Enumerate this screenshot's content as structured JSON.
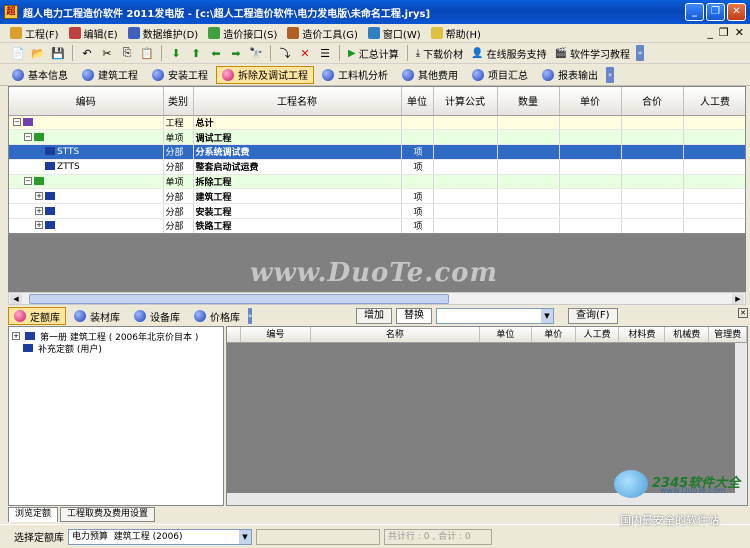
{
  "window": {
    "title": "超人电力工程造价软件 2011发电版 - [c:\\超人工程造价软件\\电力发电版\\未命名工程.jrys]",
    "minimize": "_",
    "restore": "❐",
    "close": "✕"
  },
  "menu": {
    "items": [
      "工程(F)",
      "编辑(E)",
      "数据维护(D)",
      "造价接口(S)",
      "造价工具(G)",
      "窗口(W)",
      "帮助(H)"
    ],
    "mdi_controls": [
      "_",
      "❐",
      "✕"
    ]
  },
  "toolbar": {
    "summary_label": "汇总计算",
    "download_price_label": "下载价材",
    "online_service_label": "在线服务支持",
    "tutorial_label": "软件学习教程"
  },
  "tabs": {
    "items": [
      "基本信息",
      "建筑工程",
      "安装工程",
      "拆除及调试工程",
      "工料机分析",
      "其他费用",
      "项目汇总",
      "报表输出"
    ],
    "active": "拆除及调试工程"
  },
  "grid": {
    "columns": [
      "编码",
      "类别",
      "工程名称",
      "单位",
      "计算公式",
      "数量",
      "单价",
      "合价",
      "人工费"
    ],
    "rows": [
      {
        "code": "",
        "type": "工程",
        "name": "总计",
        "unit": "",
        "style": "sum",
        "level": 0
      },
      {
        "code": "",
        "type": "单项",
        "name": "调试工程",
        "unit": "",
        "style": "item",
        "level": 1
      },
      {
        "code": "STTS",
        "type": "分部",
        "name": "分系统调试费",
        "unit": "项",
        "style": "sel",
        "level": 2
      },
      {
        "code": "ZTTS",
        "type": "分部",
        "name": "整套启动试运费",
        "unit": "项",
        "style": "",
        "level": 2
      },
      {
        "code": "",
        "type": "单项",
        "name": "拆除工程",
        "unit": "",
        "style": "item",
        "level": 1
      },
      {
        "code": "",
        "type": "分部",
        "name": "建筑工程",
        "unit": "项",
        "style": "",
        "level": 2
      },
      {
        "code": "",
        "type": "分部",
        "name": "安装工程",
        "unit": "项",
        "style": "",
        "level": 2
      },
      {
        "code": "",
        "type": "分部",
        "name": "铁路工程",
        "unit": "项",
        "style": "",
        "level": 2
      }
    ]
  },
  "watermark": "www.DuoTe.com",
  "library": {
    "tabs": [
      "定额库",
      "装材库",
      "设备库",
      "价格库"
    ],
    "active": "定额库",
    "add_label": "增加",
    "replace_label": "替换",
    "search_label": "查询(F)",
    "tree": [
      "第一册 建筑工程 ( 2006年北京价目本 )",
      "补充定额 (用户)"
    ],
    "columns": [
      "编号",
      "名称",
      "单位",
      "单价",
      "人工费",
      "材料费",
      "机械费",
      "管理费"
    ]
  },
  "bottom_tabs": [
    "浏览定额",
    "工程取费及费用设置"
  ],
  "status": {
    "label": "选择定额库",
    "budget_type": "电力预算",
    "book": "建筑工程 (2006)",
    "hint": "共计行 : 0 , 合计 : 0"
  },
  "brand": {
    "logo": "2345软件大全",
    "url": "www.DuoTe.com",
    "slogan": "国内最安全的软件站"
  },
  "colors": {
    "titlebar": "#0a54d0",
    "selected_row": "#316ac5",
    "sum_row": "#fffde0",
    "item_row": "#e8ffe0",
    "active_tab": "#ffe6a0"
  }
}
